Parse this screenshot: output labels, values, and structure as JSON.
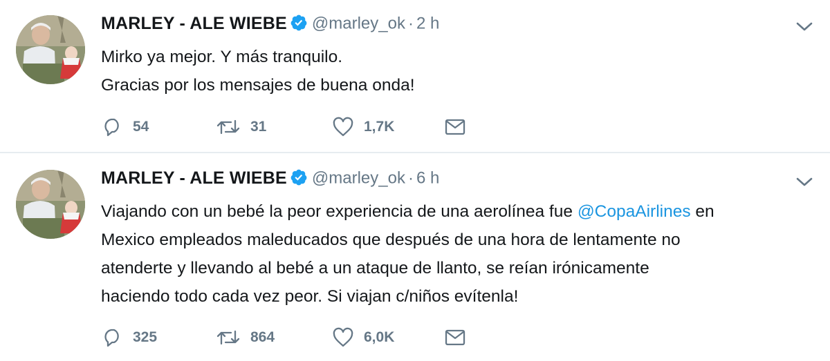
{
  "tweets": [
    {
      "fullname": "MARLEY - ALE WIEBE",
      "username": "@marley_ok",
      "separator": "·",
      "time": "2 h",
      "lines": [
        "Mirko ya mejor. Y más tranquilo.",
        "Gracias por los mensajes de buena onda!"
      ],
      "replies": "54",
      "retweets": "31",
      "likes": "1,7K"
    },
    {
      "fullname": "MARLEY - ALE WIEBE",
      "username": "@marley_ok",
      "separator": "·",
      "time": "6 h",
      "line1_before": "Viajando con un bebé la peor experiencia de una aerolínea fue ",
      "mention": "@CopaAirlines",
      "line1_after": " en",
      "lines_rest": [
        "Mexico empleados maleducados que después de una hora de lentamente no",
        "atenderte y llevando al bebé a un ataque de llanto, se reían irónicamente",
        "haciendo todo cada vez peor. Si viajan c/niños evítenla!"
      ],
      "replies": "325",
      "retweets": "864",
      "likes": "6,0K"
    }
  ],
  "colors": {
    "accent": "#1b95e0",
    "verified": "#1da1f2",
    "muted": "#657786",
    "text": "#14171a",
    "divider": "#e6ecf0"
  },
  "icons": [
    "reply-icon",
    "retweet-icon",
    "like-icon",
    "direct-message-icon",
    "chevron-down-icon",
    "verified-badge-icon"
  ]
}
